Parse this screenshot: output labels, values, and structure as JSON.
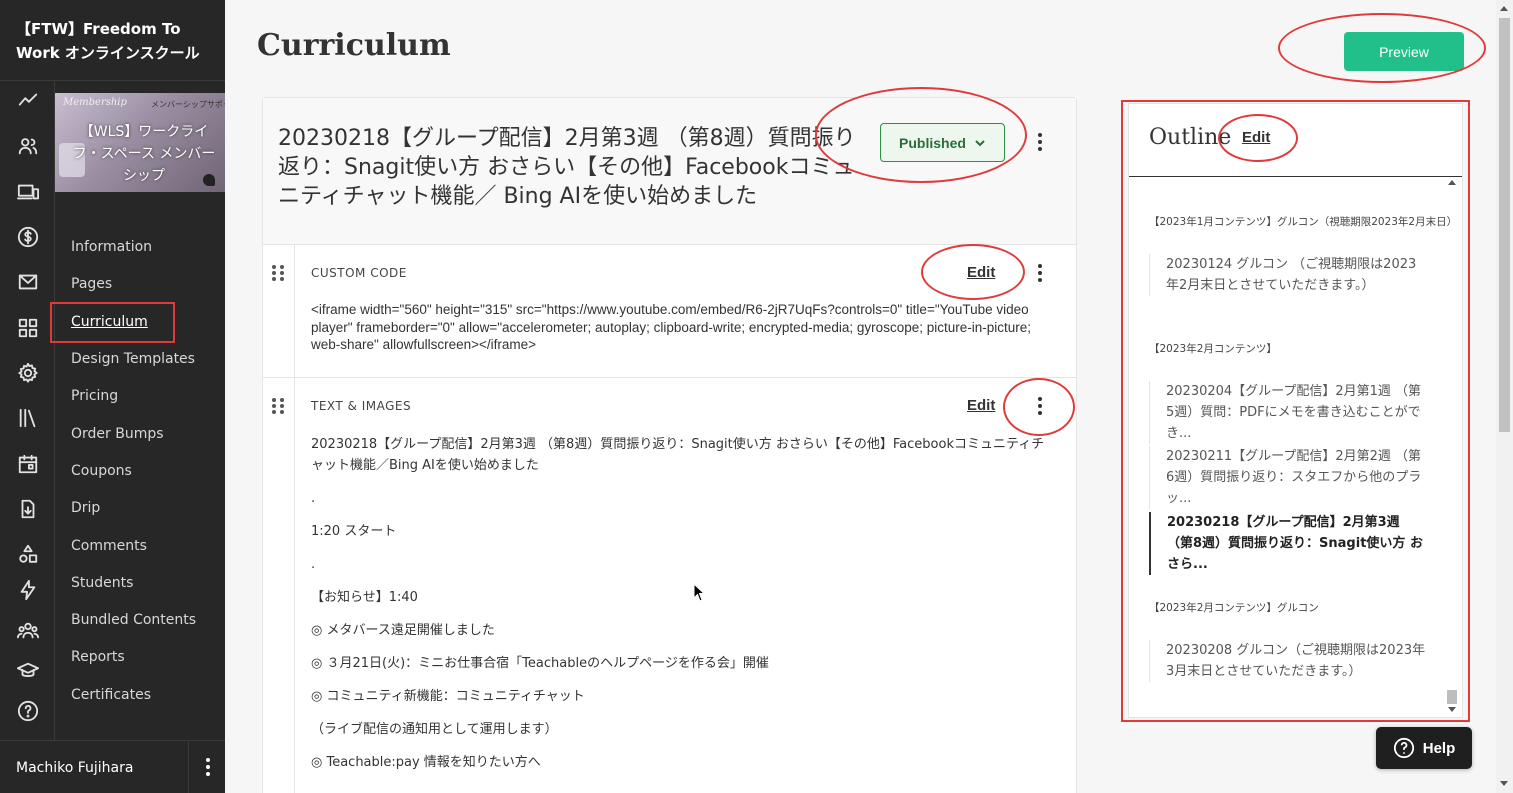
{
  "school": {
    "name": "【FTW】Freedom To Work オンラインスクール"
  },
  "course": {
    "thumbnail_title": "【WLS】ワークライフ・スペース メンバーシップ",
    "thumbnail_small": "メンバーシップサポー",
    "thumbnail_script": "Membership"
  },
  "rail_icons": [
    "trend-icon",
    "users-icon",
    "devices-icon",
    "dollar-icon",
    "mail-icon",
    "grid-icon",
    "gear-icon",
    "library-icon",
    "calendar-icon",
    "download-icon",
    "shapes-icon",
    "lightning-icon",
    "group-icon",
    "graduation-icon",
    "help-circle-icon"
  ],
  "nav": {
    "items": [
      {
        "label": "Information"
      },
      {
        "label": "Pages"
      },
      {
        "label": "Curriculum"
      },
      {
        "label": "Design Templates"
      },
      {
        "label": "Pricing"
      },
      {
        "label": "Order Bumps"
      },
      {
        "label": "Coupons"
      },
      {
        "label": "Drip"
      },
      {
        "label": "Comments"
      },
      {
        "label": "Students"
      },
      {
        "label": "Bundled Contents"
      },
      {
        "label": "Reports"
      },
      {
        "label": "Certificates"
      }
    ],
    "active": "Curriculum"
  },
  "user": {
    "name": "Machiko Fujihara"
  },
  "page": {
    "title": "Curriculum",
    "preview_label": "Preview"
  },
  "lecture": {
    "title": "20230218【グループ配信】2月第3週 （第8週）質問振り返り：Snagit使い方 おさらい【その他】Facebookコミュニティチャット機能／ Bing AIを使い始めました",
    "status": "Published"
  },
  "blocks": {
    "code": {
      "type": "CUSTOM CODE",
      "edit_label": "Edit",
      "content": "<iframe width=\"560\" height=\"315\" src=\"https://www.youtube.com/embed/R6-2jR7UqFs?controls=0\" title=\"YouTube video player\" frameborder=\"0\" allow=\"accelerometer; autoplay; clipboard-write; encrypted-media; gyroscope; picture-in-picture; web-share\" allowfullscreen></iframe>"
    },
    "text": {
      "type": "TEXT & IMAGES",
      "edit_label": "Edit",
      "lines": [
        "20230218【グループ配信】2月第3週 （第8週）質問振り返り：Snagit使い方 おさらい【その他】Facebookコミュニティチャット機能／Bing AIを使い始めました",
        ".",
        "1:20 スタート",
        ".",
        "【お知らせ】1:40",
        "◎ メタバース遠足開催しました",
        "◎ ３月21日(火)：ミニお仕事合宿「Teachableのヘルプページを作る会」開催",
        "◎ コミュニティ新機能：コミュニティチャット",
        "（ライブ配信の通知用として運用します）",
        "◎ Teachable:pay 情報を知りたい方へ"
      ]
    }
  },
  "outline": {
    "title": "Outline",
    "edit_label": "Edit",
    "sections": [
      {
        "label": "【2023年1月コンテンツ】グルコン（視聴期限2023年2月末日）",
        "items": [
          "20230124 グルコン （ご視聴期限は2023年2月末日とさせていただきます。）"
        ]
      },
      {
        "label": "【2023年2月コンテンツ】",
        "items": [
          "20230204【グループ配信】2月第1週 （第5週）質問：PDFにメモを書き込むことができ...",
          "20230211【グループ配信】2月第2週 （第6週）質問振り返り：スタエフから他のプラッ...",
          "20230218【グループ配信】2月第3週 （第8週）質問振り返り：Snagit使い方 おさら..."
        ]
      },
      {
        "label": "【2023年2月コンテンツ】グルコン",
        "items": [
          "20230208 グルコン（ご視聴期限は2023年3月末日とさせていただきます。）"
        ]
      }
    ]
  },
  "help": {
    "label": "Help"
  },
  "colors": {
    "sidebar": "#272727",
    "accent": "#21c08b",
    "published": "#2f8f47",
    "annotation": "#e03b3b"
  }
}
